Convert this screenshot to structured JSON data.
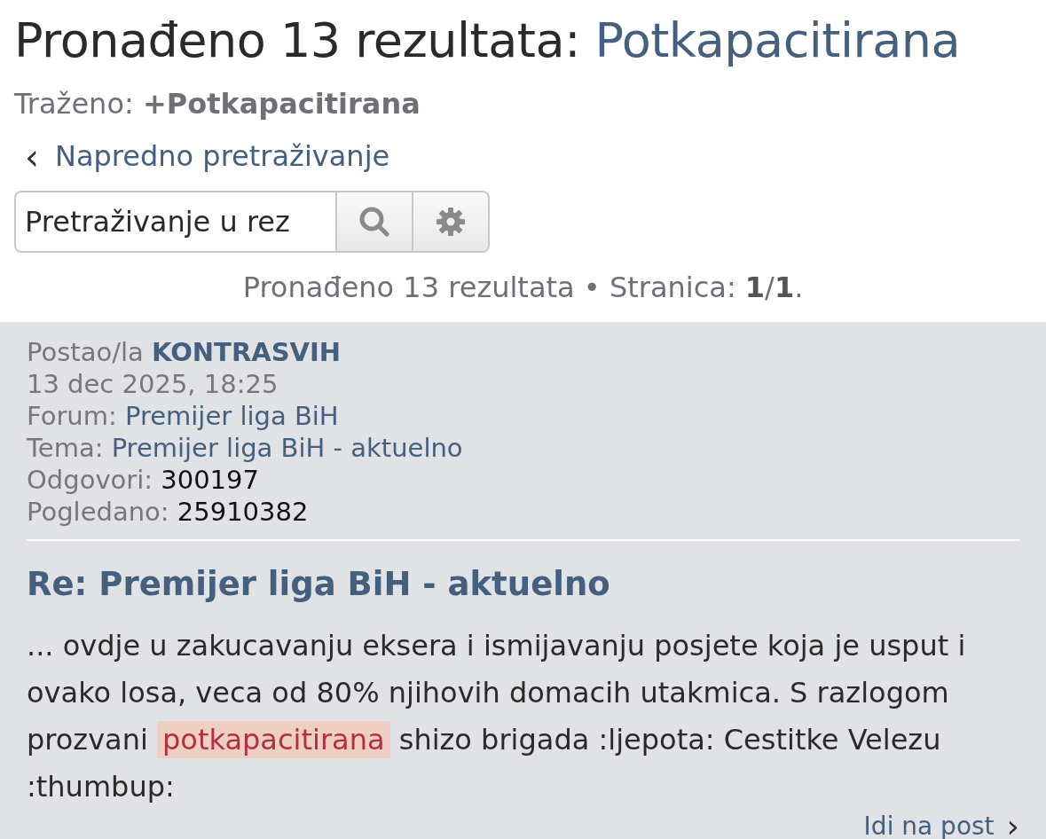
{
  "heading": {
    "prefix": "Pronađeno 13 rezultata:",
    "query": "Potkapacitirana"
  },
  "searched": {
    "label": "Traženo:",
    "terms": "+Potkapacitirana"
  },
  "back_link": {
    "icon": "‹",
    "label": "Napredno pretraživanje"
  },
  "search": {
    "placeholder": "Pretraživanje u rez"
  },
  "pagination": {
    "summary": "Pronađeno 13 rezultata • Stranica:",
    "current": "1",
    "separator": "/",
    "total": "1",
    "end": "."
  },
  "results": [
    {
      "author_label": "Postao/la",
      "author": "KONTRASVIH",
      "date": "13 dec 2025, 18:25",
      "meta": [
        {
          "label": "Forum:",
          "value": "Premijer liga BiH",
          "kind": "link"
        },
        {
          "label": "Tema:",
          "value": "Premijer liga BiH - aktuelno",
          "kind": "link"
        },
        {
          "label": "Odgovori:",
          "value": "300197",
          "kind": "number"
        },
        {
          "label": "Pogledano:",
          "value": "25910382",
          "kind": "number"
        }
      ],
      "title": "Re: Premijer liga BiH - aktuelno",
      "body": [
        {
          "text": "... ovdje u zakucavanju eksera i ismijavanju posjete koja je usput i ovako losa, veca od 80% njihovih domacih utakmica. S razlogom prozvani ",
          "highlighted": false
        },
        {
          "text": "potkapacitirana",
          "highlighted": true
        },
        {
          "text": " shizo brigada :ljepota: Cestitke Velezu :thumbup:",
          "highlighted": false
        }
      ],
      "goto": "Idi na post",
      "goto_icon": "›"
    }
  ]
}
